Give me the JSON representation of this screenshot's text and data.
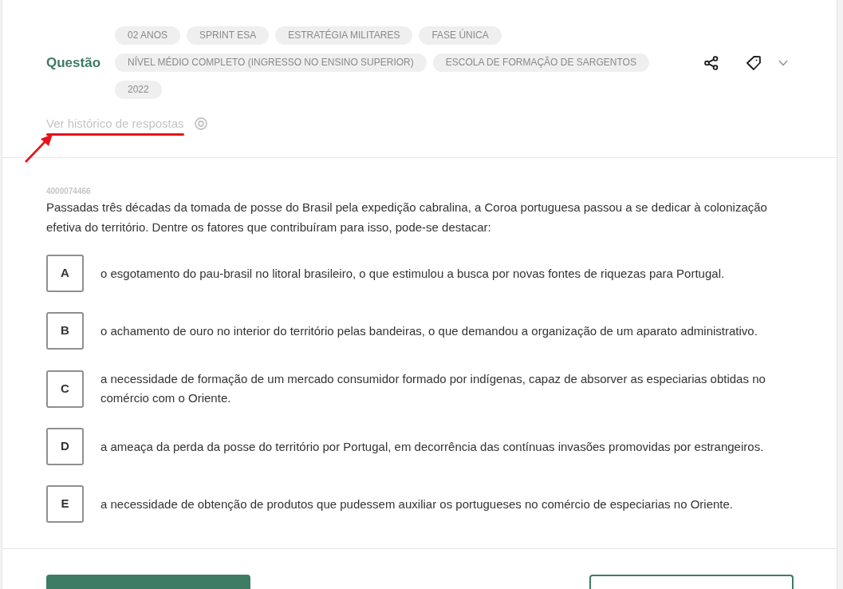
{
  "header": {
    "title": "Questão",
    "tags": [
      "02 ANOS",
      "SPRINT ESA",
      "ESTRATÉGIA MILITARES",
      "FASE ÚNICA",
      "NÍVEL MÉDIO COMPLETO (INGRESSO NO ENSINO SUPERIOR)",
      "ESCOLA DE FORMAÇÃO DE SARGENTOS",
      "2022"
    ]
  },
  "history_link": {
    "label": "Ver histórico de respostas",
    "highlighted": true
  },
  "question": {
    "id": "4000074466",
    "text": "Passadas três décadas da tomada de posse do Brasil pela expedição cabralina, a Coroa portuguesa passou a se dedicar à colonização efetiva do território. Dentre os fatores que contribuíram para isso, pode-se destacar:",
    "alternatives": [
      {
        "letter": "A",
        "text": "o esgotamento do pau-brasil no litoral brasileiro, o que estimulou a busca por novas fontes de riquezas para Portugal.",
        "selected": false
      },
      {
        "letter": "B",
        "text": "o achamento de ouro no interior do território pelas bandeiras, o que demandou a organização de um aparato administrativo.",
        "selected": false
      },
      {
        "letter": "C",
        "text": "a necessidade de formação de um mercado consumidor formado por indígenas, capaz de absorver as especiarias obtidas no comércio com o Oriente.",
        "selected": false
      },
      {
        "letter": "D",
        "text": "a ameaça da perda da posse do território por Portugal, em decorrência das contínuas invasões promovidas por estrangeiros.",
        "selected": false
      },
      {
        "letter": "E",
        "text": "a necessidade de obtenção de produtos que pudessem auxiliar os portugueses no comércio de especiarias no Oriente.",
        "selected": false
      }
    ]
  },
  "buttons": [
    {
      "kind": "filled"
    },
    {
      "kind": "outline"
    }
  ]
}
